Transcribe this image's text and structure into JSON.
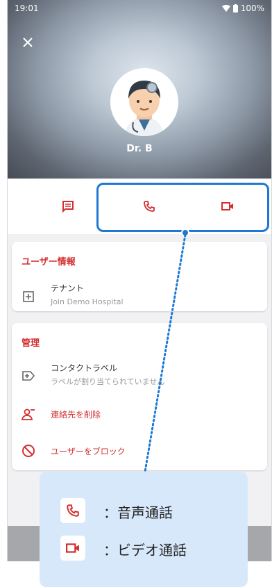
{
  "status": {
    "time": "19:01",
    "battery": "100%"
  },
  "profile": {
    "name": "Dr. B"
  },
  "actions": {
    "chat_icon": "chat-icon",
    "call_icon": "phone-icon",
    "video_icon": "video-icon"
  },
  "user_info": {
    "title": "ユーザー情報",
    "tenant_label": "テナント",
    "tenant_value": "Join Demo Hospital"
  },
  "management": {
    "title": "管理",
    "contact_label_title": "コンタクトラベル",
    "contact_label_sub": "ラベルが割り当てられていません",
    "delete_contact": "連絡先を削除",
    "block_user": "ユーザーをブロック"
  },
  "legend": {
    "voice_call": "：音声通話",
    "video_call": "：ビデオ通話"
  },
  "colors": {
    "accent": "#d32f2f",
    "highlight": "#1f78d1",
    "legend_bg": "#d8e8fb"
  }
}
